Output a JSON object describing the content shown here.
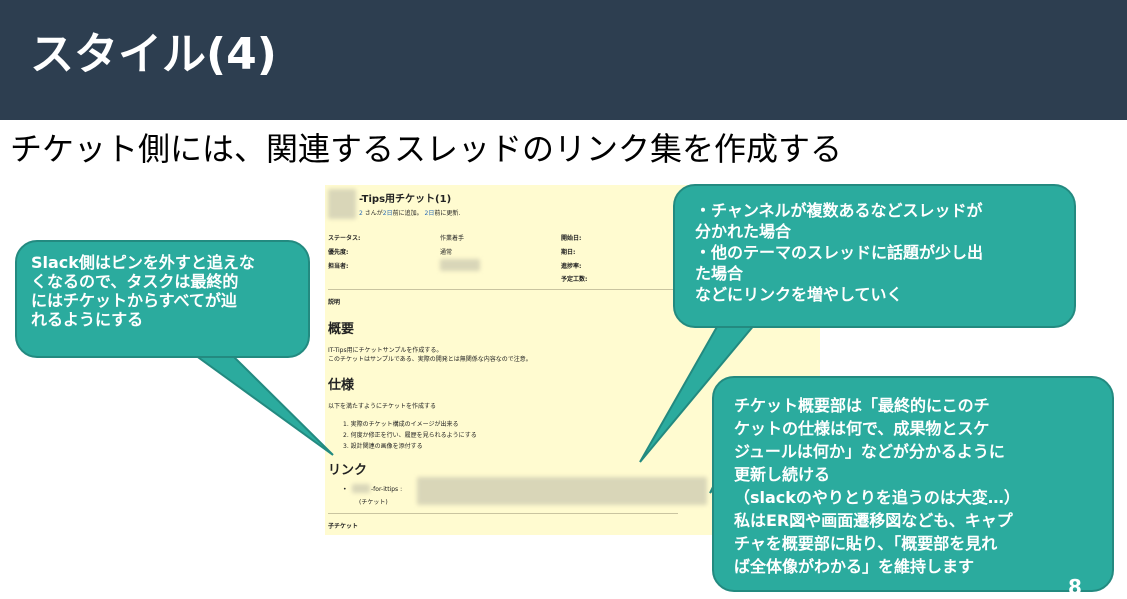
{
  "slide": {
    "title": "スタイル(4)",
    "subtitle": "チケット側には、関連するスレッドのリンク集を作成する",
    "page_number": "8"
  },
  "ticket": {
    "title": "-Tips用チケット(1)",
    "meta_prefix": "さんが",
    "meta_added": "2日",
    "meta_mid": "前に追加。",
    "meta_updated": "2日",
    "meta_suffix": "前に更新.",
    "fields": {
      "status_label": "ステータス:",
      "status_value": "作業着手",
      "priority_label": "優先度:",
      "priority_value": "通常",
      "assignee_label": "担当者:",
      "start_label": "開始日:",
      "due_label": "期日:",
      "progress_label": "進捗率:",
      "estimate_label": "予定工数:"
    },
    "description_label": "説明",
    "overview_heading": "概要",
    "overview_lines": [
      "IT-Tips用にチケットサンプルを作成する。",
      "このチケットはサンプルである、実際の開発とは無関係な内容なので注意。"
    ],
    "spec_heading": "仕様",
    "spec_intro": "以下を満たすようにチケットを作成する",
    "spec_items": [
      "1. 実際のチケット構成のイメージが出来る",
      "2. 何度か修正を行い、履歴を見られるようにする",
      "3. 設計関連の画像を添付する"
    ],
    "link_heading": "リンク",
    "link_item": "-for-ittips :",
    "link_sub": "(チケット)",
    "child_label": "子チケット"
  },
  "callouts": {
    "left": "Slack側はピンを外すと追えな\nくなるので、タスクは最終的\nにはチケットからすべてが辿\nれるようにする",
    "top_right": "・チャンネルが複数あるなどスレッドが\n分かれた場合\n・他のテーマのスレッドに話題が少し出\nた場合\nなどにリンクを増やしていく",
    "bottom_right": "チケット概要部は「最終的にこのチ\nケットの仕様は何で、成果物とスケ\nジュールは何か」などが分かるように\n更新し続ける\n（slackのやりとりを追うのは大変…）\n私はER図や画面遷移図なども、キャプ\nチャを概要部に貼り、「概要部を見れ\nば全体像がわかる」を維持します"
  },
  "colors": {
    "header_bg": "#2d3e50",
    "callout_bg": "#2bab9e",
    "ticket_bg": "#fffbd0",
    "link_blue": "#2a6bb5"
  }
}
